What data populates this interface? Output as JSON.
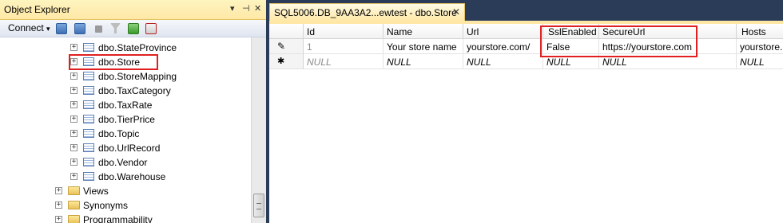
{
  "object_explorer": {
    "title": "Object Explorer",
    "title_controls": {
      "pin": "▾",
      "autohide": "⊣",
      "close": "✕"
    },
    "toolbar": {
      "connect_label": "Connect",
      "connect_dropdown": "▾",
      "icons": [
        "connect-object-icon",
        "disconnect-icon",
        "stop-icon",
        "filter-icon",
        "refresh-icon",
        "activity-monitor-icon"
      ]
    },
    "tree": [
      {
        "label": "dbo.StateProvince",
        "kind": "table"
      },
      {
        "label": "dbo.Store",
        "kind": "table",
        "highlighted": true
      },
      {
        "label": "dbo.StoreMapping",
        "kind": "table"
      },
      {
        "label": "dbo.TaxCategory",
        "kind": "table"
      },
      {
        "label": "dbo.TaxRate",
        "kind": "table"
      },
      {
        "label": "dbo.TierPrice",
        "kind": "table"
      },
      {
        "label": "dbo.Topic",
        "kind": "table"
      },
      {
        "label": "dbo.UrlRecord",
        "kind": "table"
      },
      {
        "label": "dbo.Vendor",
        "kind": "table"
      },
      {
        "label": "dbo.Warehouse",
        "kind": "table"
      },
      {
        "label": "Views",
        "kind": "folder"
      },
      {
        "label": "Synonyms",
        "kind": "folder"
      },
      {
        "label": "Programmability",
        "kind": "folder"
      }
    ],
    "expander_symbol": "+"
  },
  "document_tab": {
    "title": "SQL5006.DB_9AA3A2...ewtest - dbo.Store",
    "close_symbol": "✕"
  },
  "grid": {
    "columns": [
      "Id",
      "Name",
      "Url",
      "SslEnabled",
      "SecureUrl",
      "Hosts"
    ],
    "rows": [
      {
        "marker": "✎",
        "cells": [
          "1",
          "Your store name",
          "yourstore.com/",
          "False",
          "https://yourstore.com",
          "yourstore."
        ]
      },
      {
        "marker": "✱",
        "cells": [
          "NULL",
          "NULL",
          "NULL",
          "NULL",
          "NULL",
          "NULL"
        ]
      }
    ],
    "highlighted_columns": [
      "SslEnabled",
      "SecureUrl"
    ]
  },
  "colors": {
    "highlight": "#e02020",
    "active_tab": "#ffe8a6",
    "background": "#2b3c59"
  }
}
